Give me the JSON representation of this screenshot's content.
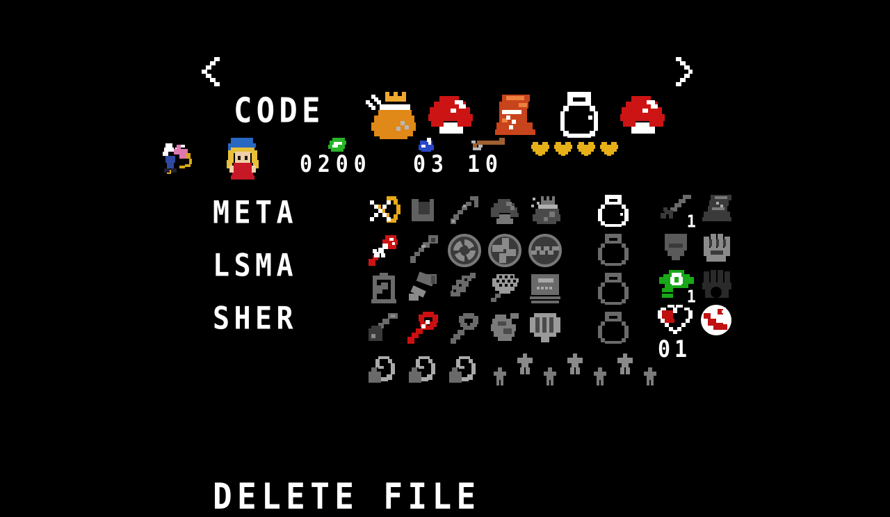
{
  "screen": {
    "background_color": "#000000",
    "title": "file-select-inventory"
  },
  "header": {
    "prev_arrow": "◀",
    "next_arrow": "▶",
    "file_name": "CODE",
    "items": [
      {
        "name": "money-bag-icon",
        "label": "Money Bag",
        "color": "#e07818"
      },
      {
        "name": "mushroom-icon",
        "label": "Mushroom",
        "color": "#c81818"
      },
      {
        "name": "boot-icon",
        "label": "Pegasus Boots",
        "color": "#d8481c"
      },
      {
        "name": "bottle-icon",
        "label": "Bottle",
        "color": "#ffffff"
      },
      {
        "name": "mushroom-icon",
        "label": "Mushroom",
        "color": "#c81818"
      }
    ]
  },
  "stats": {
    "sprites": [
      {
        "name": "fairy-sprite",
        "label": "Fairy"
      },
      {
        "name": "player-sprite",
        "label": "Player"
      }
    ],
    "counters": [
      {
        "name": "rupee-counter",
        "icon": "rupee-icon",
        "value": "0200",
        "color": "#28b428"
      },
      {
        "name": "bomb-counter",
        "icon": "bomb-icon",
        "value": "03",
        "color": "#2848c8"
      },
      {
        "name": "arrow-counter",
        "icon": "arrow-icon",
        "value": "10",
        "color": "#a06030"
      }
    ],
    "hearts": {
      "count": 4,
      "color": "#e8b018",
      "label": "Heart Containers"
    }
  },
  "names": [
    {
      "text": "META"
    },
    {
      "text": "LSMA"
    },
    {
      "text": "SHER"
    }
  ],
  "inventory": {
    "rows": [
      [
        {
          "name": "bow-icon",
          "label": "Bow",
          "owned": true,
          "color": "#e8a818"
        },
        {
          "name": "boomerang-icon",
          "label": "Boomerang",
          "owned": false
        },
        {
          "name": "hookshot-icon",
          "label": "Hookshot",
          "owned": false
        },
        {
          "name": "mushroom-icon",
          "label": "Mushroom",
          "owned": false
        },
        {
          "name": "powder-bag-icon",
          "label": "Magic Powder",
          "owned": false
        }
      ],
      [
        {
          "name": "fire-rod-icon",
          "label": "Fire Rod",
          "owned": true,
          "color": "#d01818"
        },
        {
          "name": "ice-rod-icon",
          "label": "Ice Rod",
          "owned": false
        },
        {
          "name": "bombos-medallion-icon",
          "label": "Bombos",
          "owned": false
        },
        {
          "name": "ether-medallion-icon",
          "label": "Ether",
          "owned": false
        },
        {
          "name": "quake-medallion-icon",
          "label": "Quake",
          "owned": false
        }
      ],
      [
        {
          "name": "lantern-icon",
          "label": "Lamp",
          "owned": false
        },
        {
          "name": "hammer-icon",
          "label": "Hammer",
          "owned": false
        },
        {
          "name": "flute-icon",
          "label": "Flute",
          "owned": false
        },
        {
          "name": "bug-net-icon",
          "label": "Bug Net",
          "owned": false
        },
        {
          "name": "book-icon",
          "label": "Book of Mudora",
          "owned": false
        }
      ],
      [
        {
          "name": "shovel-icon",
          "label": "Shovel",
          "owned": false
        },
        {
          "name": "magic-cape-icon",
          "label": "Cane of Somaria",
          "owned": true,
          "color": "#d01818"
        },
        {
          "name": "cane-byrna-icon",
          "label": "Cane of Byrna",
          "owned": false
        },
        {
          "name": "cape-icon",
          "label": "Magic Cape",
          "owned": false
        },
        {
          "name": "mirror-icon",
          "label": "Magic Mirror",
          "owned": false
        }
      ]
    ],
    "bottles": [
      {
        "name": "bottle-slot-1",
        "label": "Bottle 1",
        "owned": true
      },
      {
        "name": "bottle-slot-2",
        "label": "Bottle 2",
        "owned": false
      },
      {
        "name": "bottle-slot-3",
        "label": "Bottle 3",
        "owned": false
      },
      {
        "name": "bottle-slot-4",
        "label": "Bottle 4",
        "owned": false
      }
    ],
    "equipment": [
      [
        {
          "name": "sword-icon",
          "label": "Sword",
          "qty": "1",
          "owned": false
        },
        {
          "name": "glove-boot-icon",
          "label": "Boots",
          "qty": "",
          "owned": false
        }
      ],
      [
        {
          "name": "shield-icon",
          "label": "Shield",
          "qty": "",
          "owned": false
        },
        {
          "name": "gauntlet-icon",
          "label": "Power Glove",
          "qty": "",
          "owned": false
        }
      ],
      [
        {
          "name": "tunic-icon",
          "label": "Green Tunic",
          "qty": "1",
          "owned": true,
          "color": "#18a818"
        },
        {
          "name": "flippers-icon",
          "label": "Flippers",
          "qty": "",
          "owned": false
        }
      ],
      [
        {
          "name": "heart-piece-icon",
          "label": "Heart Piece",
          "qty": "",
          "owned": true,
          "color": "#c01010"
        },
        {
          "name": "moon-pearl-icon",
          "label": "Moon Pearl",
          "qty": "",
          "owned": true,
          "color": "#c01010"
        }
      ]
    ],
    "equipment_count": "01",
    "bomb_bags": [
      {
        "name": "bomb-bag-icon",
        "label": "Bomb Bag 1"
      },
      {
        "name": "bomb-bag-icon",
        "label": "Bomb Bag 2"
      },
      {
        "name": "bomb-bag-icon",
        "label": "Bomb Bag 3"
      }
    ],
    "crystals": [
      {
        "name": "crystal-icon",
        "label": "Crystal 1",
        "raised": false
      },
      {
        "name": "crystal-icon",
        "label": "Crystal 2",
        "raised": true
      },
      {
        "name": "crystal-icon",
        "label": "Crystal 3",
        "raised": false
      },
      {
        "name": "crystal-icon",
        "label": "Crystal 4",
        "raised": true
      },
      {
        "name": "crystal-icon",
        "label": "Crystal 5",
        "raised": false
      },
      {
        "name": "crystal-icon",
        "label": "Crystal 6",
        "raised": true
      },
      {
        "name": "crystal-icon",
        "label": "Crystal 7",
        "raised": false
      }
    ]
  },
  "footer": {
    "delete_label": "DELETE FILE"
  }
}
